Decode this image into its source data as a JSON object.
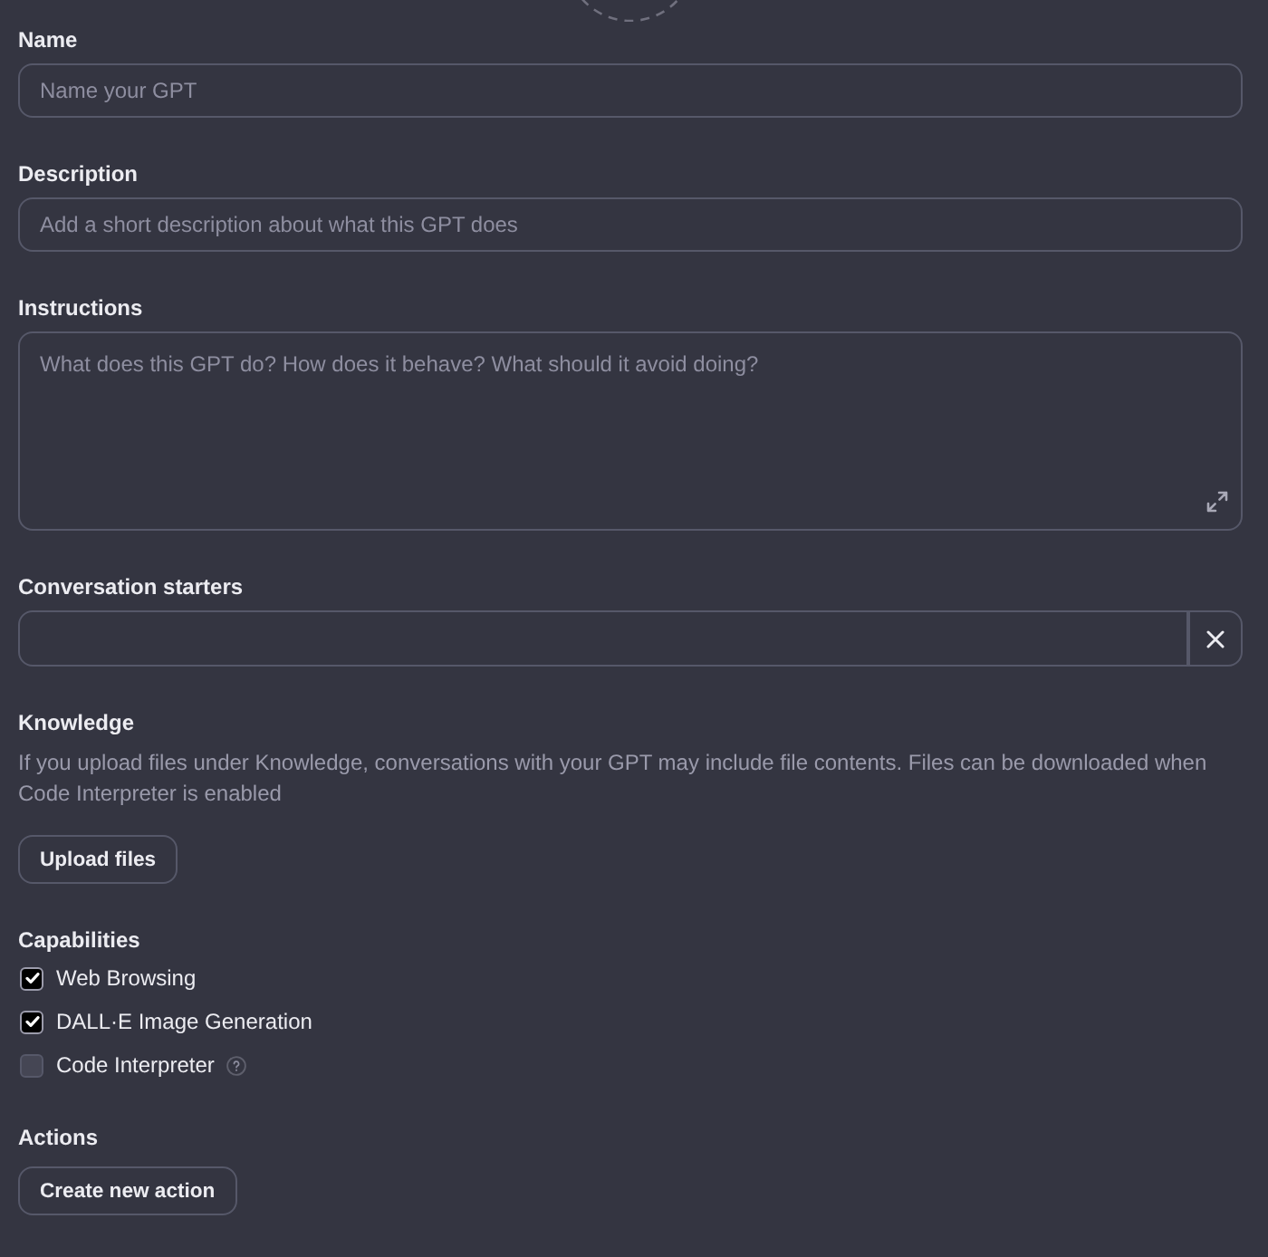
{
  "fields": [
    {
      "label": "Name",
      "kind": "input",
      "placeholder": "Name your GPT"
    },
    {
      "label": "Description",
      "kind": "input",
      "placeholder": "Add a short description about what this GPT does"
    },
    {
      "label": "Instructions",
      "kind": "textarea",
      "placeholder": "What does this GPT do? How does it behave? What should it avoid doing?"
    },
    {
      "label": "Conversation starters",
      "kind": "starter"
    }
  ],
  "knowledge": {
    "label": "Knowledge",
    "note": "If you upload files under Knowledge, conversations with your GPT may include file contents. Files can be downloaded when Code Interpreter is enabled",
    "button": "Upload files"
  },
  "capabilities": {
    "label": "Capabilities",
    "items": [
      {
        "label": "Web Browsing",
        "checked": true
      },
      {
        "label": "DALL·E Image Generation",
        "checked": true
      },
      {
        "label": "Code Interpreter",
        "checked": false,
        "help": true
      }
    ]
  },
  "actions": {
    "label": "Actions",
    "button": "Create new action"
  }
}
